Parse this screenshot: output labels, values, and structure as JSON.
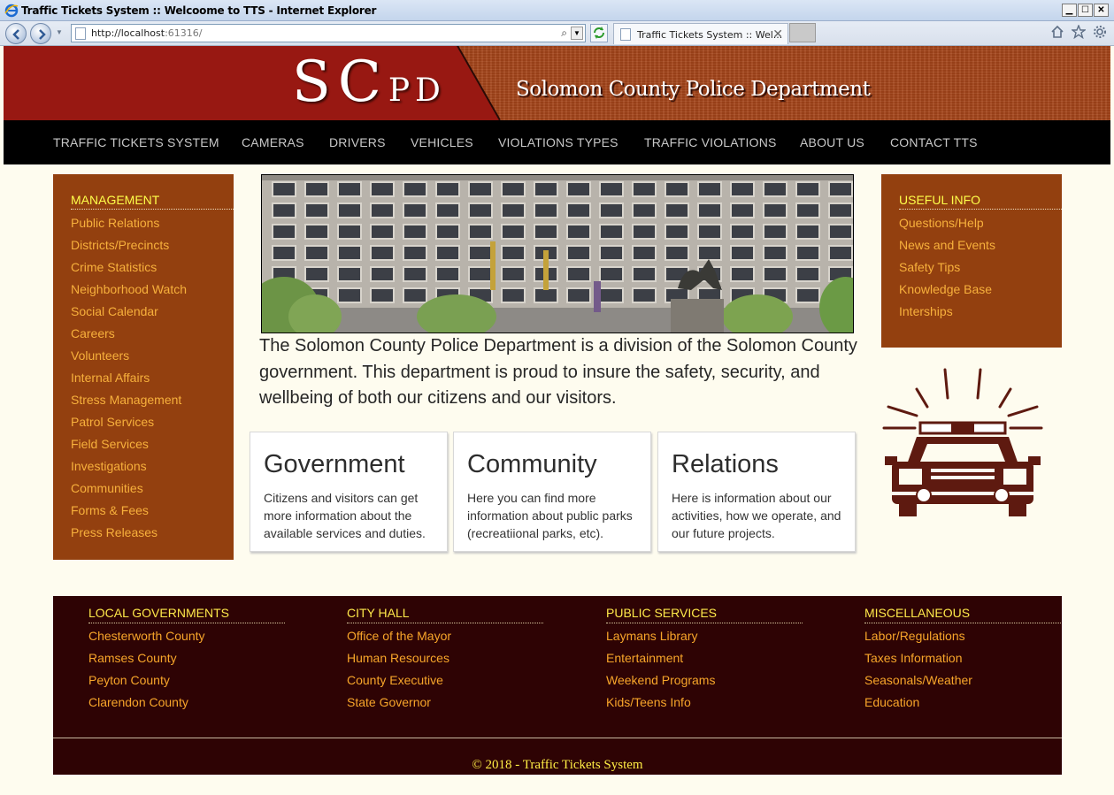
{
  "browser": {
    "title": "Traffic Tickets System :: Welcoome to TTS - Internet Explorer",
    "url_host": "http://localhost",
    "url_port": ":61316/",
    "tab_title": "Traffic Tickets System :: Wel...",
    "tab_close": "✕",
    "minimize": "▁",
    "maximize": "☐",
    "close": "✕",
    "search_glyph": "⌕",
    "dropdown_glyph": "▼",
    "toolbar_icons": [
      "home-icon",
      "star-icon",
      "gear-icon"
    ]
  },
  "header": {
    "logo_big": "SC",
    "logo_small": "PD",
    "department": "Solomon County Police Department"
  },
  "nav": {
    "items": [
      "TRAFFIC TICKETS SYSTEM",
      "CAMERAS",
      "DRIVERS",
      "VEHICLES",
      "VIOLATIONS TYPES",
      "TRAFFIC VIOLATIONS",
      "ABOUT US",
      "CONTACT TTS"
    ]
  },
  "management": {
    "title": "MANAGEMENT",
    "links": [
      "Public Relations",
      "Districts/Precincts",
      "Crime Statistics",
      "Neighborhood Watch",
      "Social Calendar",
      "Careers",
      "Volunteers",
      "Internal Affairs",
      "Stress Management",
      "Patrol Services",
      "Field Services",
      "Investigations",
      "Communities",
      "Forms & Fees",
      "Press Releases"
    ]
  },
  "intro": {
    "text": "The Solomon County Police Department is a division of the Solomon County government. This department is proud to insure the safety, security, and wellbeing of both our citizens and our visitors."
  },
  "cards": [
    {
      "title": "Government",
      "body": "Citizens and visitors can get more information about the available services and duties."
    },
    {
      "title": "Community",
      "body": "Here you can find more information about public parks (recreatiional parks, etc)."
    },
    {
      "title": "Relations",
      "body": "Here is information about our activities, how we operate, and our future projects."
    }
  ],
  "useful_info": {
    "title": "USEFUL INFO",
    "links": [
      "Questions/Help",
      "News and Events",
      "Safety Tips",
      "Knowledge Base",
      "Interships"
    ]
  },
  "footer": {
    "columns": [
      {
        "title": "LOCAL GOVERNMENTS",
        "links": [
          "Chesterworth County",
          "Ramses County",
          "Peyton County",
          "Clarendon County"
        ]
      },
      {
        "title": "CITY HALL",
        "links": [
          "Office of the Mayor",
          "Human Resources",
          "County Executive",
          "State Governor"
        ]
      },
      {
        "title": "PUBLIC SERVICES",
        "links": [
          "Laymans Library",
          "Entertainment",
          "Weekend Programs",
          "Kids/Teens Info"
        ]
      },
      {
        "title": "MISCELLANEOUS",
        "links": [
          "Labor/Regulations",
          "Taxes Information",
          "Seasonals/Weather",
          "Education"
        ]
      }
    ],
    "copyright": "© 2018 - Traffic Tickets System"
  },
  "colors": {
    "header_red": "#981812",
    "header_brick": "#a5451a",
    "sidebar_brown": "#93400f",
    "link_orange": "#f7b03c",
    "title_yellow": "#ffff4a",
    "footer_bg": "#2e0304",
    "page_bg": "#fefcef"
  }
}
